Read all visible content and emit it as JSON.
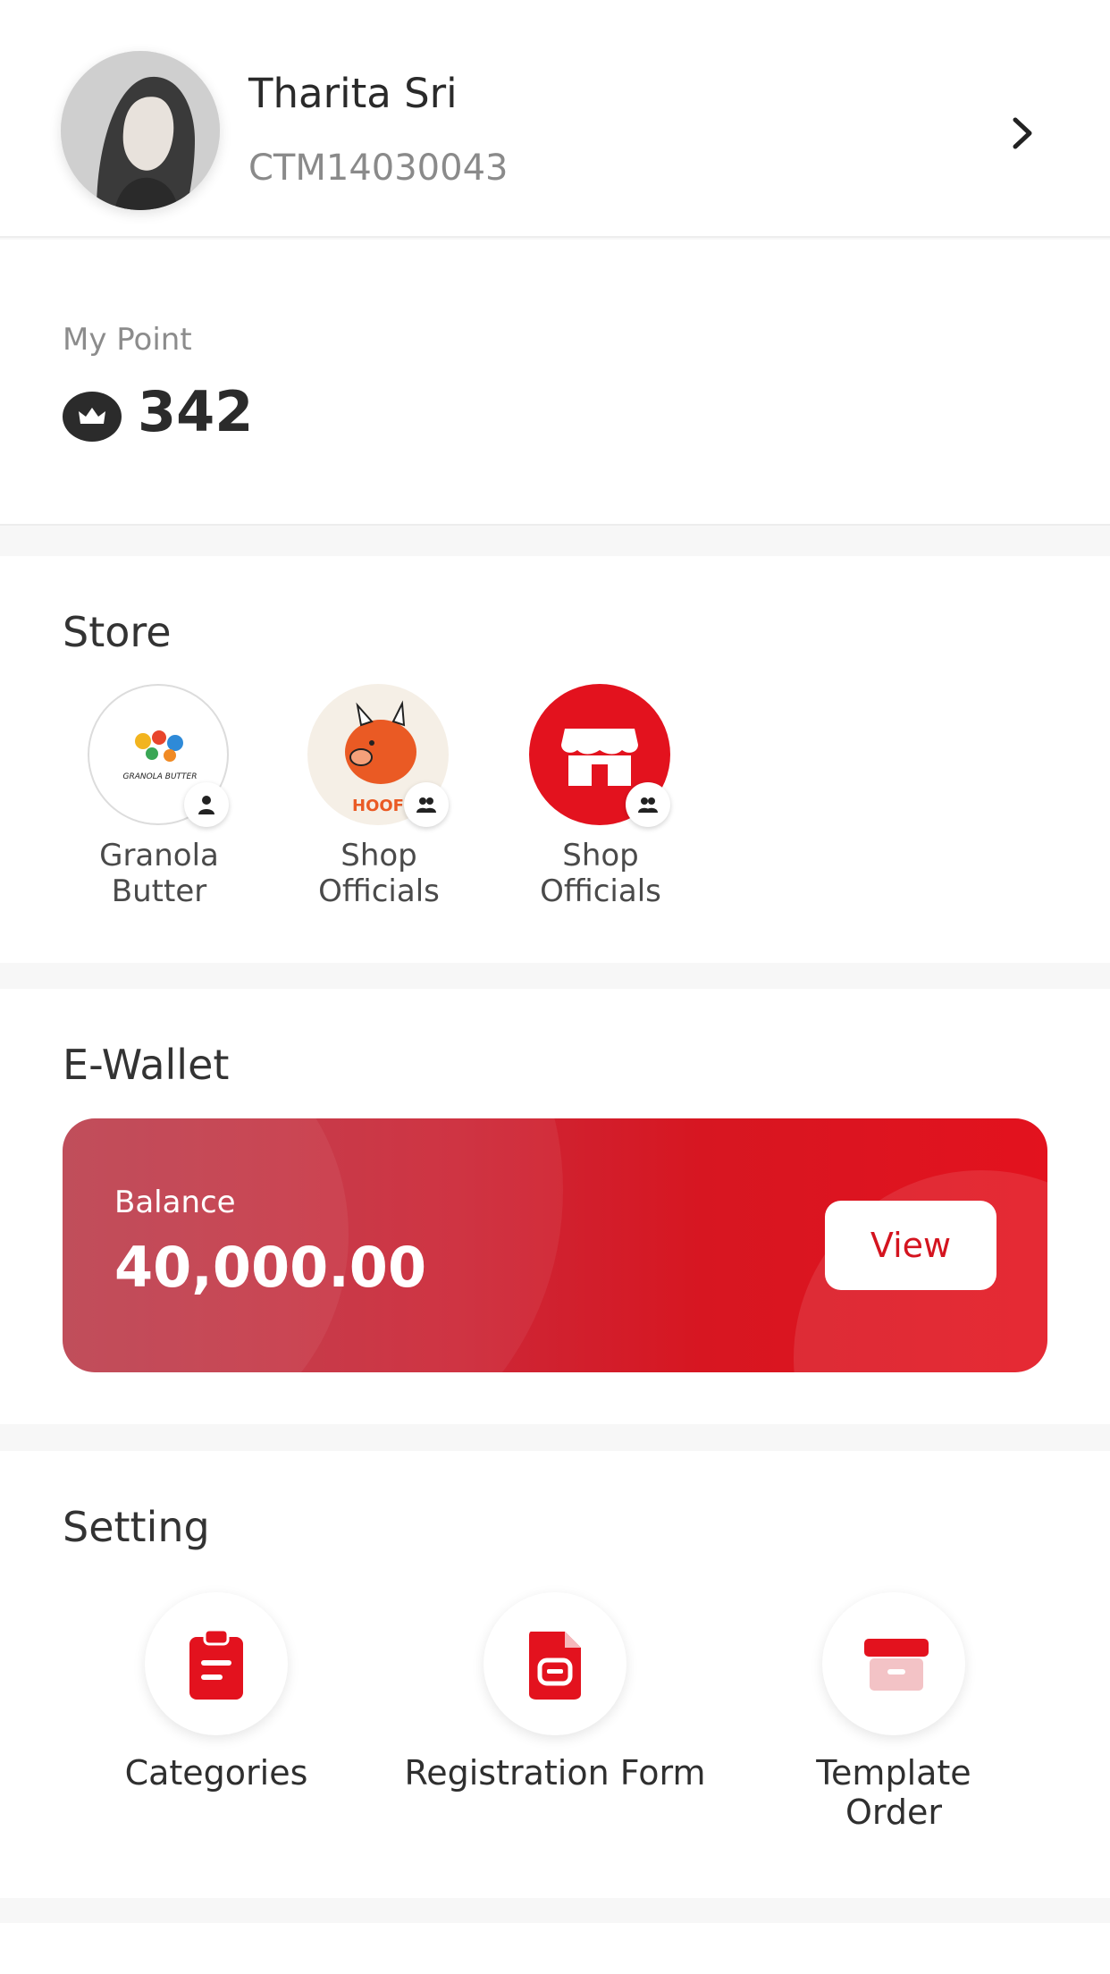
{
  "profile": {
    "name": "Tharita Sri",
    "customer_id": "CTM14030043"
  },
  "points": {
    "label": "My Point",
    "value": "342"
  },
  "store": {
    "title": "Store",
    "items": [
      {
        "label": "Granola Butter",
        "logo_text": "GRANOLA BUTTER",
        "badge_icon": "person-icon"
      },
      {
        "label": "Shop Officials",
        "logo_text": "HOOF",
        "badge_icon": "group-icon"
      },
      {
        "label": "Shop Officials",
        "logo_text": "",
        "badge_icon": "group-icon"
      }
    ]
  },
  "wallet": {
    "title": "E-Wallet",
    "balance_label": "Balance",
    "balance_value": "40,000.00",
    "view_label": "View"
  },
  "setting": {
    "title": "Setting",
    "items": [
      {
        "label": "Categories",
        "icon": "clipboard-icon"
      },
      {
        "label": "Registration Form",
        "icon": "document-icon"
      },
      {
        "label": "Template Order",
        "icon": "archive-box-icon"
      }
    ]
  },
  "colors": {
    "accent": "#e3121e",
    "text_dark": "#2b2b2b",
    "text_muted": "#8a8a8a",
    "background": "#f7f7f7"
  }
}
